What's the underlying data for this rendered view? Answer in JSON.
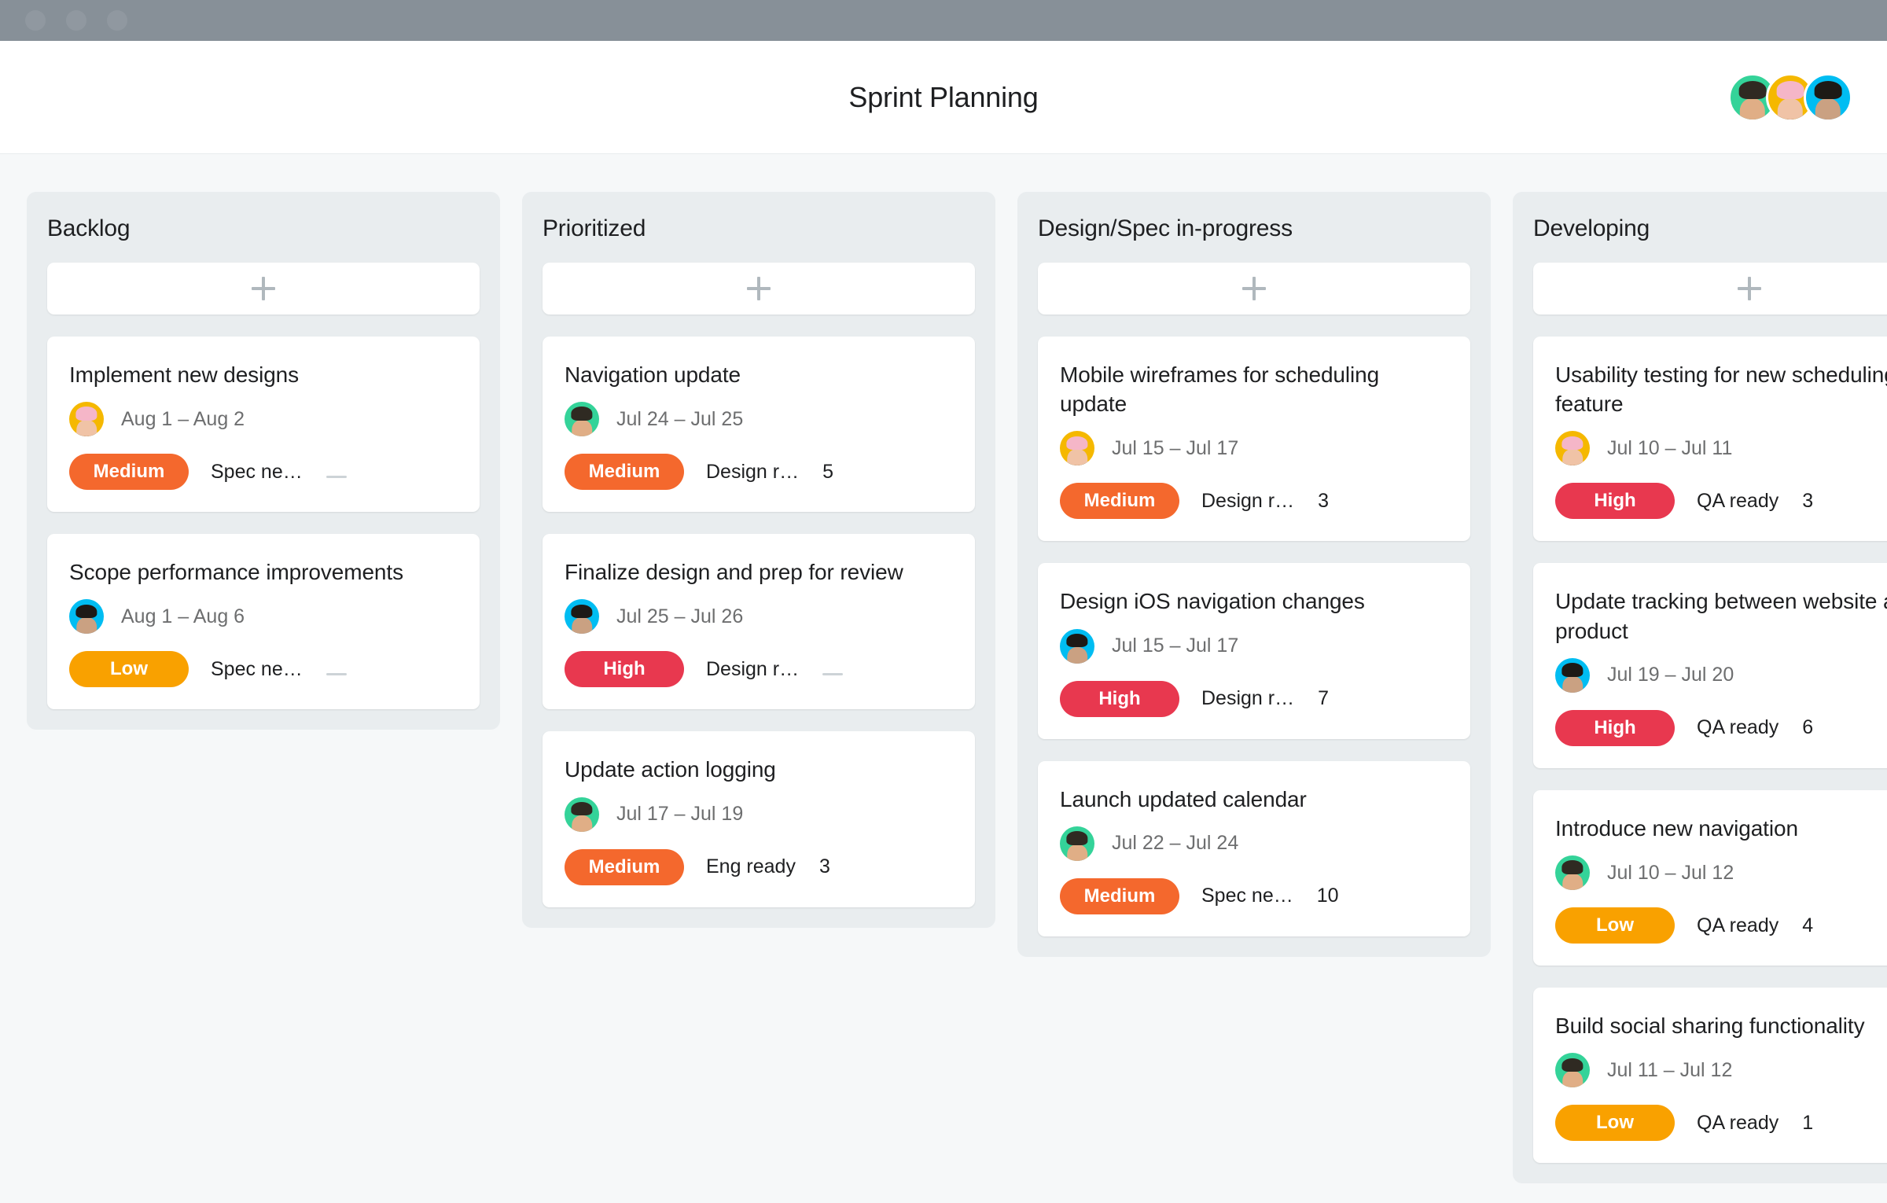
{
  "window": {
    "traffic_lights": [
      "close",
      "minimize",
      "zoom"
    ],
    "chrome_color": "#879098"
  },
  "header": {
    "title": "Sprint Planning",
    "members": [
      {
        "name": "avatar-green",
        "ring_color": "#34d399",
        "hair_color": "#2f2a22",
        "skin_color": "#e0ae86",
        "body_color": "#9aa5ad"
      },
      {
        "name": "avatar-yellow",
        "ring_color": "#f5b800",
        "hair_color": "#f5b6c8",
        "skin_color": "#f0c3a6",
        "body_color": "#2a2a2a"
      },
      {
        "name": "avatar-cyan",
        "ring_color": "#00bdf2",
        "hair_color": "#1d1a16",
        "skin_color": "#caa182",
        "body_color": "#b98d8d"
      }
    ]
  },
  "board": {
    "add_card_icon": "plus-icon",
    "priority_colors": {
      "High": "#e8384f",
      "Medium": "#f4682d",
      "Low": "#f9a100"
    },
    "columns": [
      {
        "title": "Backlog",
        "cards": [
          {
            "title": "Implement new designs",
            "dates": "Aug 1 – Aug 2",
            "assignee": "avatar-yellow",
            "priority": "Medium",
            "status": "Spec ne…",
            "count": "—"
          },
          {
            "title": "Scope performance improvements",
            "dates": "Aug 1 – Aug 6",
            "assignee": "avatar-cyan",
            "priority": "Low",
            "status": "Spec ne…",
            "count": "—"
          }
        ]
      },
      {
        "title": "Prioritized",
        "cards": [
          {
            "title": "Navigation update",
            "dates": "Jul 24 – Jul 25",
            "assignee": "avatar-green",
            "priority": "Medium",
            "status": "Design r…",
            "count": "5"
          },
          {
            "title": "Finalize design and prep for review",
            "dates": "Jul 25 – Jul 26",
            "assignee": "avatar-cyan",
            "priority": "High",
            "status": "Design r…",
            "count": "—"
          },
          {
            "title": "Update action logging",
            "dates": "Jul 17 – Jul 19",
            "assignee": "avatar-green",
            "priority": "Medium",
            "status": "Eng ready",
            "count": "3"
          }
        ]
      },
      {
        "title": "Design/Spec in-progress",
        "cards": [
          {
            "title": "Mobile wireframes for scheduling update",
            "dates": "Jul 15 – Jul 17",
            "assignee": "avatar-yellow",
            "priority": "Medium",
            "status": "Design r…",
            "count": "3"
          },
          {
            "title": "Design iOS navigation changes",
            "dates": "Jul 15 – Jul 17",
            "assignee": "avatar-cyan",
            "priority": "High",
            "status": "Design r…",
            "count": "7"
          },
          {
            "title": "Launch updated calendar",
            "dates": "Jul 22 – Jul 24",
            "assignee": "avatar-green",
            "priority": "Medium",
            "status": "Spec ne…",
            "count": "10"
          }
        ]
      },
      {
        "title": "Developing",
        "cards": [
          {
            "title": "Usability testing for new scheduling feature",
            "dates": "Jul 10 – Jul 11",
            "assignee": "avatar-yellow",
            "priority": "High",
            "status": "QA ready",
            "count": "3"
          },
          {
            "title": "Update tracking between website and product",
            "dates": "Jul 19 – Jul 20",
            "assignee": "avatar-cyan",
            "priority": "High",
            "status": "QA ready",
            "count": "6"
          },
          {
            "title": "Introduce new navigation",
            "dates": "Jul 10 – Jul 12",
            "assignee": "avatar-green",
            "priority": "Low",
            "status": "QA ready",
            "count": "4"
          },
          {
            "title": "Build social sharing functionality",
            "dates": "Jul 11 – Jul 12",
            "assignee": "avatar-green",
            "priority": "Low",
            "status": "QA ready",
            "count": "1"
          }
        ]
      }
    ]
  }
}
